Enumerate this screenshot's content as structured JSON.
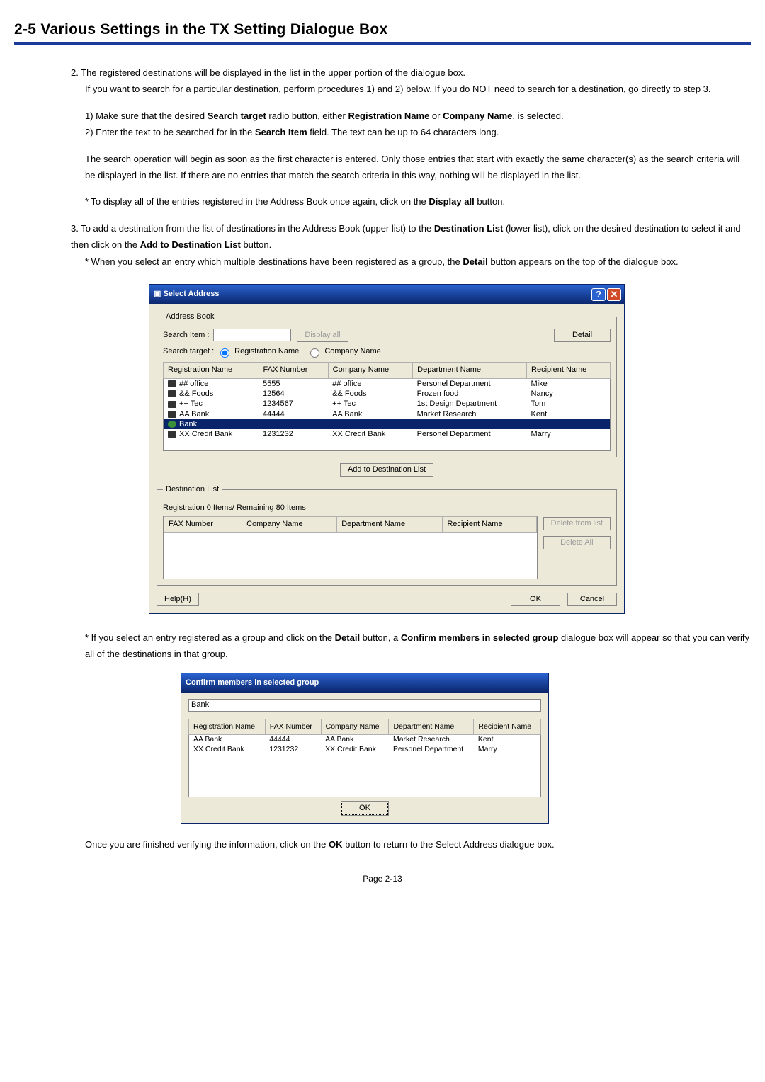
{
  "section_title": "2-5  Various Settings in the TX Setting Dialogue Box",
  "step2_lead": "2. The registered destinations will be displayed in the list in the upper portion of the dialogue box.",
  "step2_b": "If you want to search for a particular destination, perform procedures 1) and 2) below. If you do NOT need to search for a destination, go directly to step 3.",
  "step2_1a": "1) Make sure that the desired ",
  "step2_1b": "Search target",
  "step2_1c": " radio button, either ",
  "step2_1d": "Registration Name",
  "step2_1e": " or ",
  "step2_1f": "Company Name",
  "step2_1g": ", is selected.",
  "step2_2a": "2) Enter the text to be searched for in the ",
  "step2_2b": "Search Item",
  "step2_2c": " field. The text can be up to 64 characters long.",
  "step2_para2": "The search operation will begin as soon as the first character is entered. Only those entries that start with exactly the same character(s) as the search criteria will be displayed in the list. If there are no entries that match the search criteria in this way, nothing will be displayed in the list.",
  "step2_star_a": "* To display all of the entries registered in the Address Book once again, click on the ",
  "step2_star_b": "Display all",
  "step2_star_c": " button.",
  "step3_a": "3. To add a destination from the list of destinations in the Address Book (upper list) to the ",
  "step3_b": "Destination List",
  "step3_c": " (lower list), click on the desired destination to select it and then click on the ",
  "step3_d": "Add to Destination List",
  "step3_e": " button.",
  "step3_star_a": "* When you select an entry which multiple destinations have been registered as a group, the ",
  "step3_star_b": "Detail",
  "step3_star_c": " button appears on the top of the dialogue box.",
  "after1_a": "* If you select an entry registered as a group and click on the ",
  "after1_b": "Detail",
  "after1_c": " button, a ",
  "after1_d": "Confirm members in selected group",
  "after1_e": " dialogue box will appear so that you can verify all of the destinations in that group.",
  "after2_a": "Once you are finished verifying the information, click on the ",
  "after2_b": "OK",
  "after2_c": " button to return to the Select Address dialogue box.",
  "page_foot": "Page 2-13",
  "dlg1": {
    "title": "Select Address",
    "ab_legend": "Address Book",
    "search_item_label": "Search Item   :",
    "display_all": "Display all",
    "detail": "Detail",
    "search_target_label": "Search target :",
    "radio1": "Registration Name",
    "radio2": "Company Name",
    "cols": {
      "reg": "Registration Name",
      "fax": "FAX Number",
      "co": "Company Name",
      "dept": "Department Name",
      "rec": "Recipient Name"
    },
    "rows": [
      {
        "reg": "## office",
        "fax": "5555",
        "co": "## office",
        "dept": "Personel Department",
        "rec": "Mike",
        "type": "fax"
      },
      {
        "reg": "&& Foods",
        "fax": "12564",
        "co": "&& Foods",
        "dept": "Frozen food",
        "rec": "Nancy",
        "type": "fax"
      },
      {
        "reg": "++ Tec",
        "fax": "1234567",
        "co": "++ Tec",
        "dept": "1st Design Department",
        "rec": "Tom",
        "type": "fax"
      },
      {
        "reg": "AA Bank",
        "fax": "44444",
        "co": "AA Bank",
        "dept": "Market Research",
        "rec": "Kent",
        "type": "fax"
      },
      {
        "reg": "Bank",
        "fax": "",
        "co": "",
        "dept": "",
        "rec": "",
        "type": "grp",
        "selected": true
      },
      {
        "reg": "XX Credit Bank",
        "fax": "1231232",
        "co": "XX Credit Bank",
        "dept": "Personel Department",
        "rec": "Marry",
        "type": "fax"
      }
    ],
    "add_btn": "Add to Destination List",
    "dest_legend": "Destination List",
    "dest_reg_line": "Registration 0 Items/ Remaining 80 Items",
    "dest_cols": {
      "fax": "FAX Number",
      "co": "Company Name",
      "dept": "Department Name",
      "rec": "Recipient Name"
    },
    "delete_from_list": "Delete from list",
    "delete_all": "Delete All",
    "help": "Help(H)",
    "ok": "OK",
    "cancel": "Cancel"
  },
  "dlg2": {
    "title": "Confirm members in selected group",
    "group_name": "Bank",
    "cols": {
      "reg": "Registration Name",
      "fax": "FAX Number",
      "co": "Company Name",
      "dept": "Department Name",
      "rec": "Recipient Name"
    },
    "rows": [
      {
        "reg": "AA Bank",
        "fax": "44444",
        "co": "AA Bank",
        "dept": "Market Research",
        "rec": "Kent"
      },
      {
        "reg": "XX Credit Bank",
        "fax": "1231232",
        "co": "XX Credit Bank",
        "dept": "Personel Department",
        "rec": "Marry"
      }
    ],
    "ok": "OK"
  }
}
